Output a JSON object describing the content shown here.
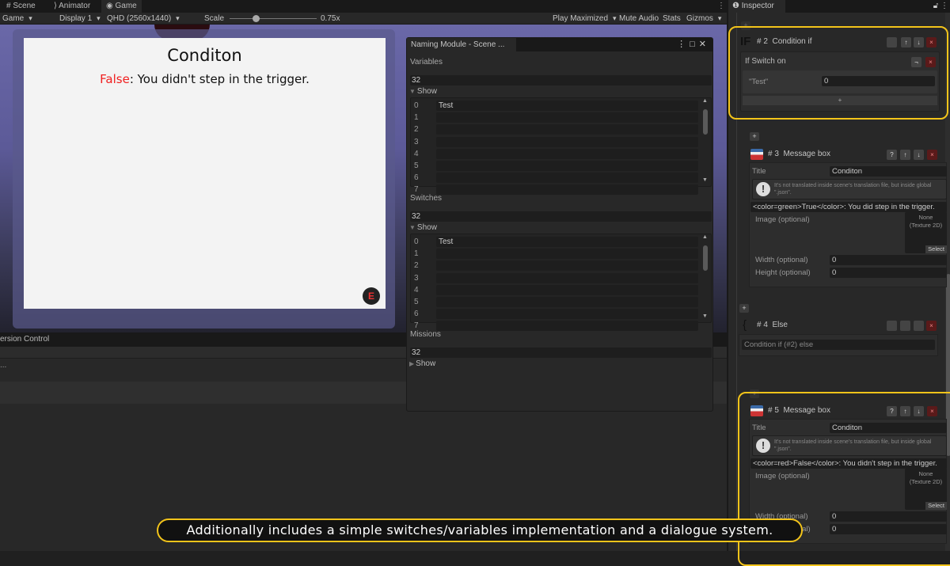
{
  "tabs": [
    "Scene",
    "Animator",
    "Game"
  ],
  "toolbar": {
    "view": "Game",
    "display": "Display 1",
    "resolution": "QHD (2560x1440)",
    "scale_label": "Scale",
    "scale_value": "0.75x",
    "scale_fraction": 0.3,
    "play_mode": "Play Maximized",
    "mute": "Mute Audio",
    "stats": "Stats",
    "gizmos": "Gizmos"
  },
  "game": {
    "title": "Conditon",
    "msg_false": "False",
    "msg_rest": ": You didn't step in the trigger.",
    "button_glyph": "E"
  },
  "version_control": {
    "title": "ersion Control",
    "row": "..."
  },
  "naming": {
    "title": "Naming Module - Scene ...",
    "sections": [
      {
        "label": "Variables",
        "count": "32",
        "show": "Show",
        "expanded": true,
        "items": [
          "Test",
          "",
          "",
          "",
          "",
          "",
          "",
          ""
        ]
      },
      {
        "label": "Switches",
        "count": "32",
        "show": "Show",
        "expanded": true,
        "items": [
          "Test",
          "",
          "",
          "",
          "",
          "",
          "",
          ""
        ]
      },
      {
        "label": "Missions",
        "count": "32",
        "show": "Show",
        "expanded": false,
        "items": []
      }
    ]
  },
  "inspector": {
    "title": "Inspector",
    "cond": {
      "icon": "IF",
      "num": "# 2",
      "name": "Condition if",
      "sub": "If  Switch on",
      "key": "\"Test\"",
      "value": "0",
      "add": "+"
    },
    "msg3": {
      "num": "# 3",
      "name": "Message box",
      "title_label": "Title",
      "title_value": "Conditon",
      "help": "It's not translated inside scene's translation file, but inside global \".json\".",
      "text": "<color=green>True</color>: You did step in the trigger.",
      "image_label": "Image (optional)",
      "image_value": "None\n(Texture 2D)",
      "select": "Select",
      "width_label": "Width (optional)",
      "width_value": "0",
      "height_label": "Height (optional)",
      "height_value": "0"
    },
    "else": {
      "icon": "{",
      "num": "# 4",
      "name": "Else",
      "ref": "Condition if (#2) else"
    },
    "msg5": {
      "num": "# 5",
      "name": "Message box",
      "title_label": "Title",
      "title_value": "Conditon",
      "help": "It's not translated inside scene's translation file, but inside global \".json\".",
      "text": "<color=red>False</color>: You didn't step in the trigger.",
      "image_label": "Image (optional)",
      "image_value": "None\n(Texture 2D)",
      "select": "Select",
      "width_label": "Width (optional)",
      "width_value": "0",
      "height_label": "Height (optional)",
      "height_value": "0"
    },
    "btn_help": "?",
    "btn_up": "↑",
    "btn_down": "↓",
    "btn_del": "×",
    "btn_plus": "+"
  },
  "caption": "Additionally includes a simple switches/variables implementation and a dialogue system.",
  "colors": {
    "highlight": "#f3c41a",
    "false_red": "#f02020"
  }
}
